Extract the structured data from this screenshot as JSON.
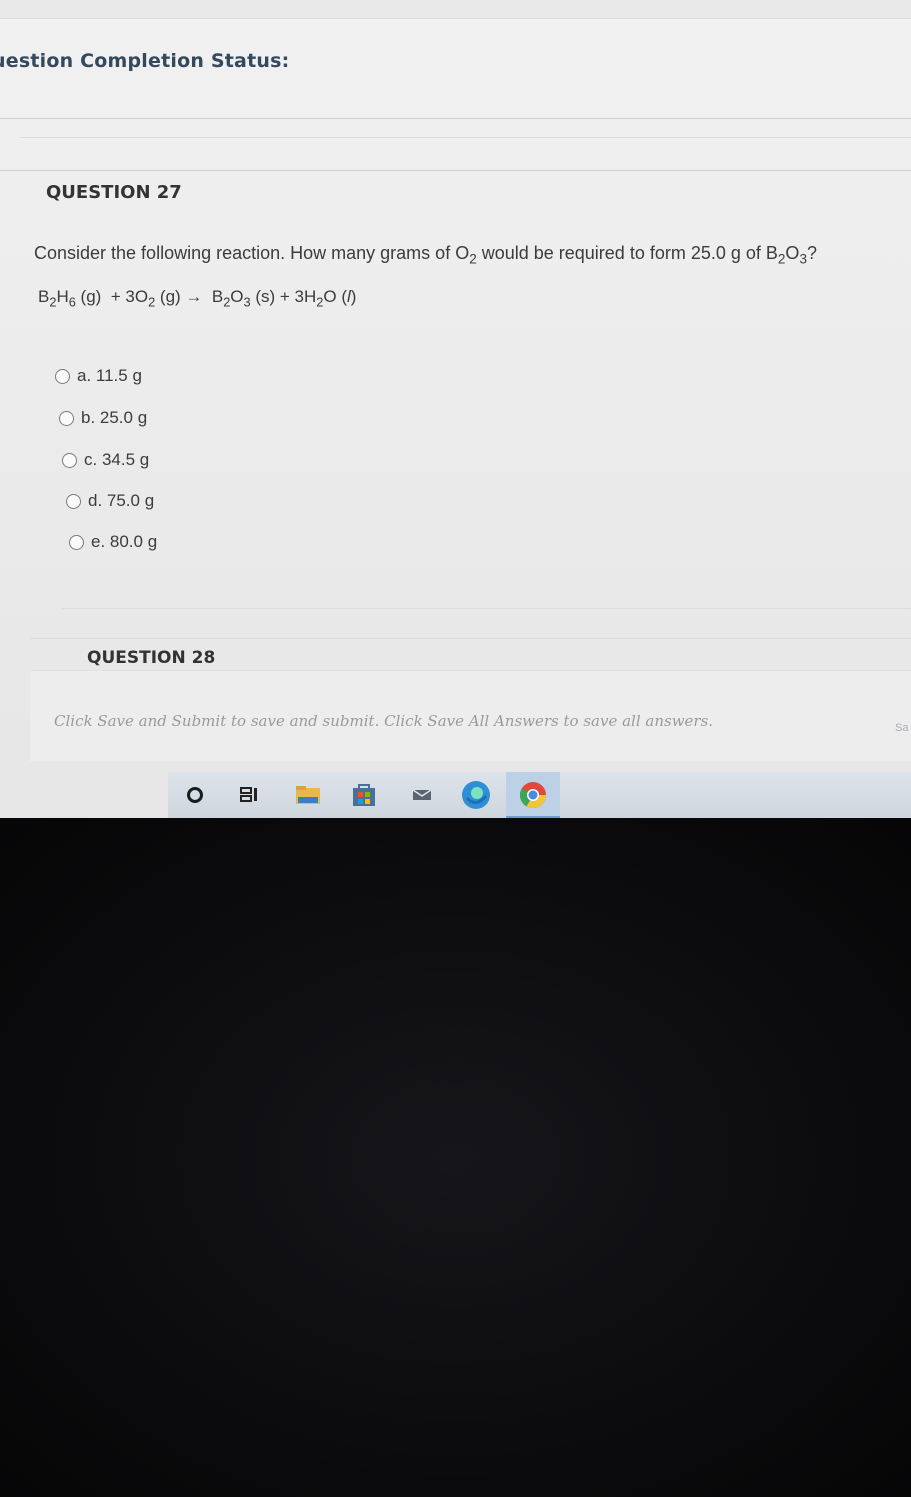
{
  "header": {
    "status_title": "uestion Completion Status:"
  },
  "question27": {
    "title": "QUESTION 27",
    "prompt_before": "Consider the following reaction. How many grams of O",
    "prompt_sub1": "2",
    "prompt_mid": " would be required to form 25.0 g of B",
    "prompt_sub2": "2",
    "prompt_o": "O",
    "prompt_sub3": "3",
    "prompt_end": "?",
    "equation": {
      "b": "B",
      "s1": "2",
      "h": "H",
      "s2": "6",
      "p1": " (g)  + 3O",
      "s3": "2",
      "p2": " (g) →  B",
      "s4": "2",
      "p3": "O",
      "s5": "3",
      "p4": " (s) + 3H",
      "s6": "2",
      "p5": "O (",
      "liq": "l",
      "p6": ")"
    },
    "choices": [
      "a. 11.5 g",
      "b. 25.0 g",
      "c. 34.5 g",
      "d. 75.0 g",
      "e. 80.0 g"
    ]
  },
  "question28": {
    "title": "QUESTION 28"
  },
  "footer": {
    "message": "Click Save and Submit to save and submit. Click Save All Answers to save all answers.",
    "save_label": "Sa"
  },
  "taskbar": {
    "icons": [
      "cortana-icon",
      "task-view-icon",
      "file-explorer-icon",
      "store-icon",
      "mail-icon",
      "edge-icon",
      "chrome-icon"
    ],
    "colors": {
      "edge": "#2d8fd6",
      "chrome_red": "#e04a3a",
      "chrome_yellow": "#f3c53a",
      "chrome_green": "#3aa757"
    }
  }
}
